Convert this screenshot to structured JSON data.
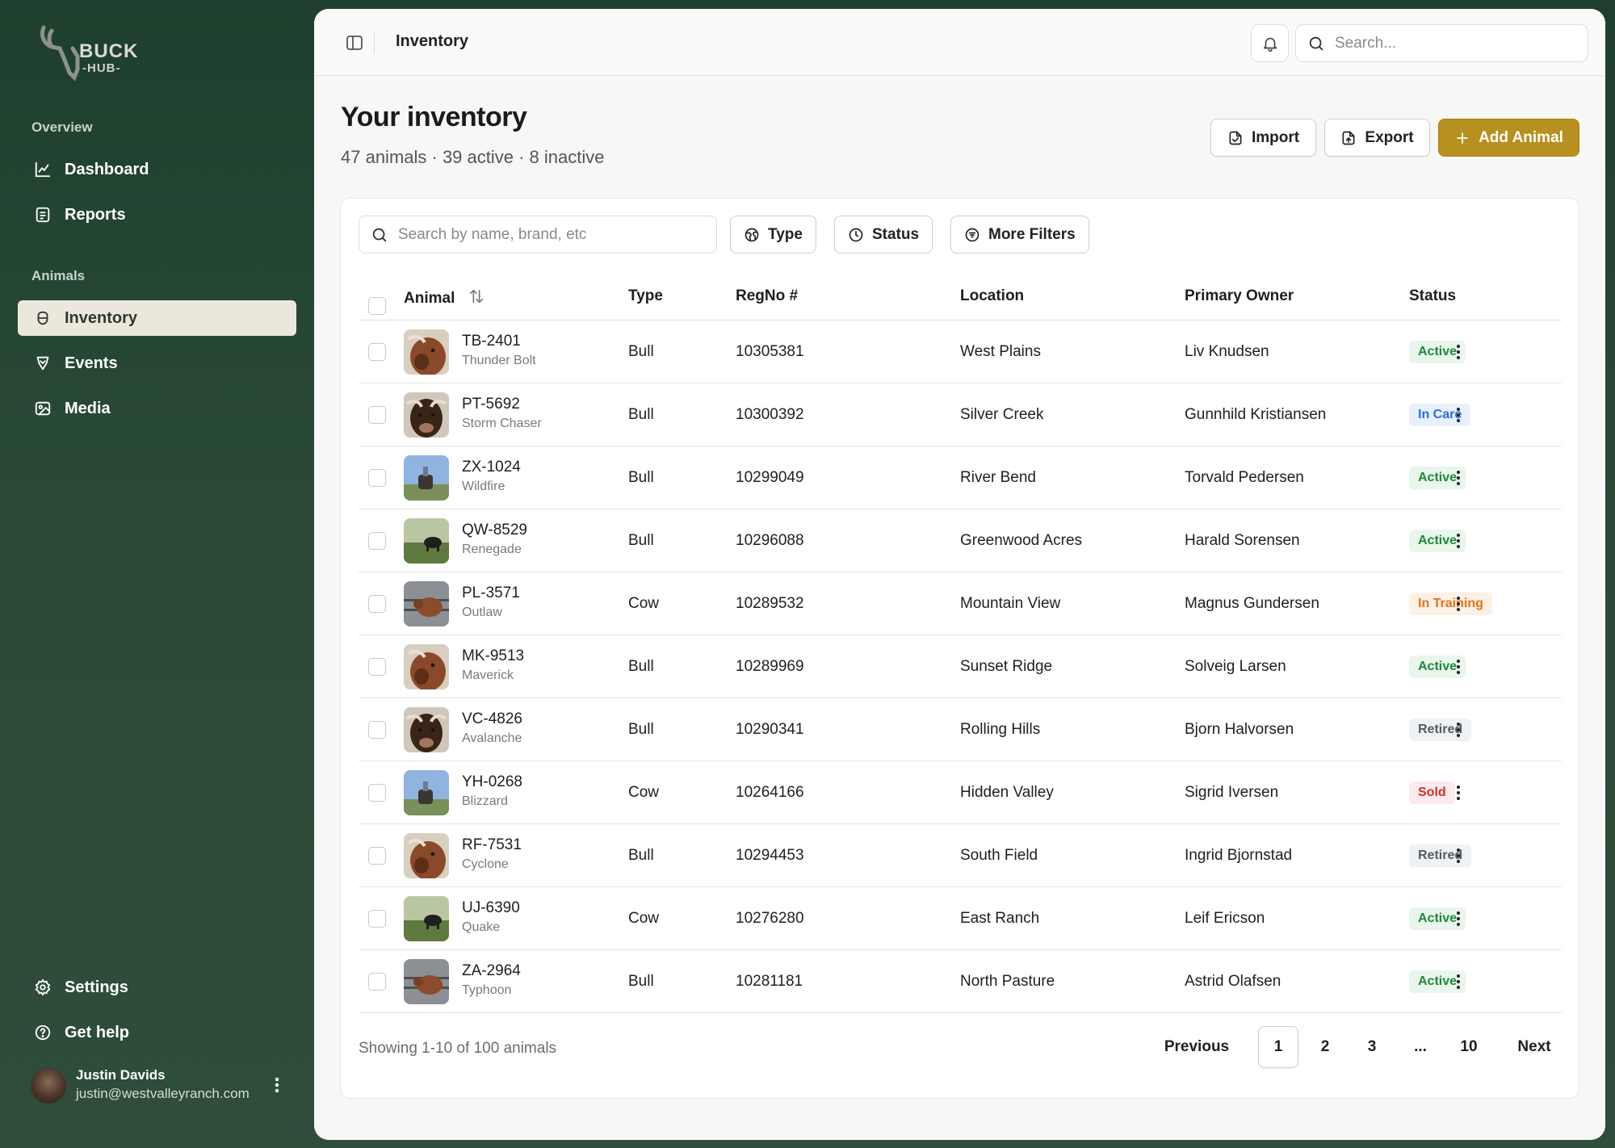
{
  "brand": {
    "name": "BUCK",
    "sub": "-HUB-"
  },
  "sidebar": {
    "sections": [
      {
        "label": "Overview"
      },
      {
        "label": "Animals"
      }
    ],
    "items": [
      {
        "label": "Dashboard",
        "icon": "chart-line-icon"
      },
      {
        "label": "Reports",
        "icon": "report-icon"
      },
      {
        "label": "Inventory",
        "icon": "cow-icon",
        "active": true
      },
      {
        "label": "Events",
        "icon": "event-icon"
      },
      {
        "label": "Media",
        "icon": "media-icon"
      }
    ],
    "bottom": [
      {
        "label": "Settings",
        "icon": "gear-icon"
      },
      {
        "label": "Get help",
        "icon": "help-icon"
      }
    ],
    "user": {
      "name": "Justin Davids",
      "email": "justin@westvalleyranch.com"
    }
  },
  "topbar": {
    "title": "Inventory",
    "search_placeholder": "Search..."
  },
  "page": {
    "title": "Your inventory",
    "subtitle": "47 animals · 39 active · 8 inactive",
    "import_label": "Import",
    "export_label": "Export",
    "add_label": "Add Animal"
  },
  "filters": {
    "search_placeholder": "Search by name, brand, etc",
    "type_label": "Type",
    "status_label": "Status",
    "more_label": "More Filters"
  },
  "table": {
    "headers": {
      "animal": "Animal",
      "type": "Type",
      "regno": "RegNo #",
      "location": "Location",
      "owner": "Primary Owner",
      "status": "Status"
    },
    "rows": [
      {
        "id": "TB-2401",
        "name": "Thunder Bolt",
        "type": "Bull",
        "regno": "10305381",
        "location": "West Plains",
        "owner": "Liv Knudsen",
        "status": "Active",
        "photo": "brown-closeup"
      },
      {
        "id": "PT-5692",
        "name": "Storm Chaser",
        "type": "Bull",
        "regno": "10300392",
        "location": "Silver Creek",
        "owner": "Gunnhild Kristiansen",
        "status": "In Care",
        "photo": "dark-closeup"
      },
      {
        "id": "ZX-1024",
        "name": "Wildfire",
        "type": "Bull",
        "regno": "10299049",
        "location": "River Bend",
        "owner": "Torvald Pedersen",
        "status": "Active",
        "photo": "sky-field"
      },
      {
        "id": "QW-8529",
        "name": "Renegade",
        "type": "Bull",
        "regno": "10296088",
        "location": "Greenwood Acres",
        "owner": "Harald Sorensen",
        "status": "Active",
        "photo": "pasture"
      },
      {
        "id": "PL-3571",
        "name": "Outlaw",
        "type": "Cow",
        "regno": "10289532",
        "location": "Mountain View",
        "owner": "Magnus Gundersen",
        "status": "In Training",
        "photo": "pen"
      },
      {
        "id": "MK-9513",
        "name": "Maverick",
        "type": "Bull",
        "regno": "10289969",
        "location": "Sunset Ridge",
        "owner": "Solveig Larsen",
        "status": "Active",
        "photo": "brown-closeup"
      },
      {
        "id": "VC-4826",
        "name": "Avalanche",
        "type": "Bull",
        "regno": "10290341",
        "location": "Rolling Hills",
        "owner": "Bjorn Halvorsen",
        "status": "Retired",
        "photo": "dark-closeup"
      },
      {
        "id": "YH-0268",
        "name": "Blizzard",
        "type": "Cow",
        "regno": "10264166",
        "location": "Hidden Valley",
        "owner": "Sigrid Iversen",
        "status": "Sold",
        "photo": "sky-field"
      },
      {
        "id": "RF-7531",
        "name": "Cyclone",
        "type": "Bull",
        "regno": "10294453",
        "location": "South Field",
        "owner": "Ingrid Bjornstad",
        "status": "Retired",
        "photo": "brown-closeup"
      },
      {
        "id": "UJ-6390",
        "name": "Quake",
        "type": "Cow",
        "regno": "10276280",
        "location": "East Ranch",
        "owner": "Leif Ericson",
        "status": "Active",
        "photo": "pasture"
      },
      {
        "id": "ZA-2964",
        "name": "Typhoon",
        "type": "Bull",
        "regno": "10281181",
        "location": "North Pasture",
        "owner": "Astrid Olafsen",
        "status": "Active",
        "photo": "pen"
      }
    ]
  },
  "status_colors": {
    "Active": {
      "fg": "#1f8a3c",
      "bg": "#e9f6ec"
    },
    "In Care": {
      "fg": "#2b6fd6",
      "bg": "#e7f0fc"
    },
    "In Training": {
      "fg": "#e0761b",
      "bg": "#fdf0e4"
    },
    "Retired": {
      "fg": "#555b66",
      "bg": "#f0f1f3"
    },
    "Sold": {
      "fg": "#d22f2f",
      "bg": "#fdeaea"
    }
  },
  "pagination": {
    "summary": "Showing 1-10 of 100 animals",
    "previous": "Previous",
    "pages": [
      "1",
      "2",
      "3",
      "...",
      "10"
    ],
    "current": "1",
    "next": "Next"
  },
  "colors": {
    "accent": "#b8901f",
    "sidebar": "#26452f"
  }
}
